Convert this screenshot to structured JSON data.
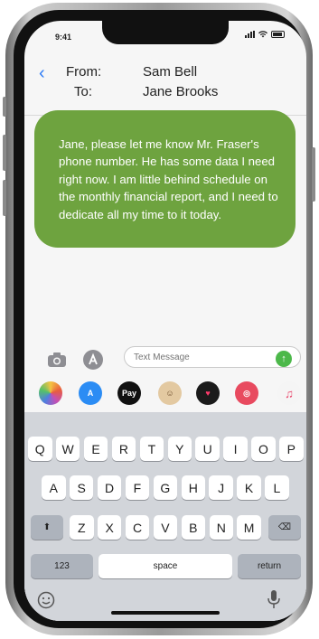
{
  "status": {
    "time": "9:41"
  },
  "header": {
    "from_label": "From:",
    "from_value": "Sam Bell",
    "to_label": "To:",
    "to_value": "Jane Brooks"
  },
  "message": {
    "text": "Jane, please let me know Mr. Fraser's phone number. He has some data I need right now. I am little behind schedule on the monthly financial report, and I need to dedicate all my time to it today."
  },
  "composer": {
    "placeholder": "Text Message"
  },
  "app_drawer": {
    "apple_pay_label": "Pay"
  },
  "keyboard": {
    "row1": [
      "Q",
      "W",
      "E",
      "R",
      "T",
      "Y",
      "U",
      "I",
      "O",
      "P"
    ],
    "row2": [
      "A",
      "S",
      "D",
      "F",
      "G",
      "H",
      "J",
      "K",
      "L"
    ],
    "row3": [
      "Z",
      "X",
      "C",
      "V",
      "B",
      "N",
      "M"
    ],
    "numbers_label": "123",
    "space_label": "space",
    "return_label": "return"
  },
  "colors": {
    "bubble": "#6ea33f",
    "accent": "#2e7cf6",
    "send": "#4cb84a"
  }
}
